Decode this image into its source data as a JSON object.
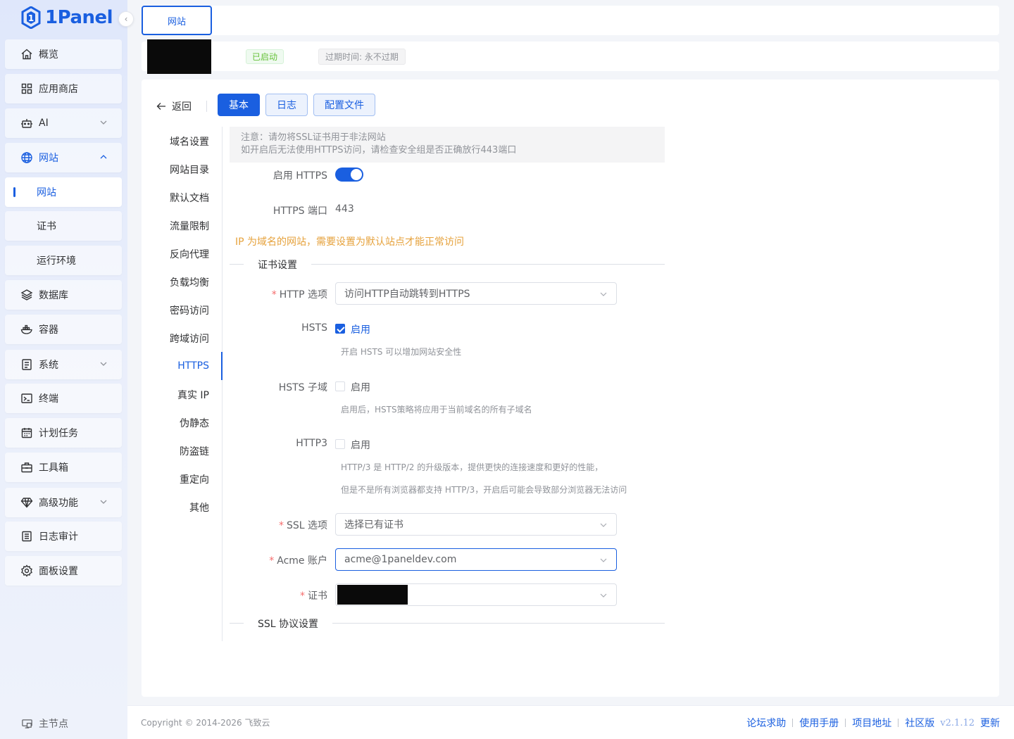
{
  "app": {
    "logo_text": "1Panel",
    "brand_color": "#1a5fe0"
  },
  "sidebar": {
    "items": [
      {
        "label": "概览",
        "icon": "home-icon"
      },
      {
        "label": "应用商店",
        "icon": "apps-grid-icon"
      },
      {
        "label": "AI",
        "icon": "robot-icon"
      },
      {
        "label": "网站",
        "icon": "globe-icon"
      },
      {
        "label": "网站"
      },
      {
        "label": "证书"
      },
      {
        "label": "运行环境"
      },
      {
        "label": "数据库",
        "icon": "layers-icon"
      },
      {
        "label": "容器",
        "icon": "docker-icon"
      },
      {
        "label": "系统",
        "icon": "server-icon"
      },
      {
        "label": "终端",
        "icon": "terminal-icon"
      },
      {
        "label": "计划任务",
        "icon": "calendar-icon"
      },
      {
        "label": "工具箱",
        "icon": "toolbox-icon"
      },
      {
        "label": "高级功能",
        "icon": "diamond-icon"
      },
      {
        "label": "日志审计",
        "icon": "log-icon"
      },
      {
        "label": "面板设置",
        "icon": "gear-icon"
      }
    ],
    "master_node": "主节点"
  },
  "tabs": {
    "active": "网站"
  },
  "site": {
    "status": "已启动",
    "status_color": "#67c23a",
    "expire": "过期时间: 永不过期"
  },
  "toolbar": {
    "back": "返回",
    "basic": "基本",
    "log": "日志",
    "config": "配置文件"
  },
  "leftnav": {
    "items": [
      "域名设置",
      "网站目录",
      "默认文档",
      "流量限制",
      "反向代理",
      "负载均衡",
      "密码访问",
      "跨域访问",
      "HTTPS",
      "真实 IP",
      "伪静态",
      "防盗链",
      "重定向",
      "其他"
    ],
    "active": "HTTPS"
  },
  "https": {
    "notice_line1": "注意：请勿将SSL证书用于非法网站",
    "notice_line2": "如开启后无法使用HTTPS访问，请检查安全组是否正确放行443端口",
    "enable_label": "启用 HTTPS",
    "enable_value": true,
    "port_label": "HTTPS 端口",
    "port_value": "443",
    "ip_warning": "IP 为域名的网站，需要设置为默认站点才能正常访问",
    "cert_section": "证书设置",
    "http_option_label": "HTTP 选项",
    "http_option_value": "访问HTTP自动跳转到HTTPS",
    "hsts_label": "HSTS",
    "hsts_checkbox": "启用",
    "hsts_checked": true,
    "hsts_help": "开启 HSTS 可以增加网站安全性",
    "hsts_sub_label": "HSTS 子域",
    "hsts_sub_checkbox": "启用",
    "hsts_sub_help": "启用后，HSTS策略将应用于当前域名的所有子域名",
    "http3_label": "HTTP3",
    "http3_checkbox": "启用",
    "http3_help1": "HTTP/3 是 HTTP/2 的升级版本，提供更快的连接速度和更好的性能，",
    "http3_help2": "但是不是所有浏览器都支持 HTTP/3，开启后可能会导致部分浏览器无法访问",
    "ssl_option_label": "SSL 选项",
    "ssl_option_value": "选择已有证书",
    "acme_label": "Acme 账户",
    "acme_value": "acme@1paneldev.com",
    "cert_label": "证书",
    "protocol_section": "SSL 协议设置"
  },
  "footer": {
    "copyright": "Copyright © 2014-2026 飞致云",
    "links": [
      "论坛求助",
      "使用手册",
      "项目地址",
      "社区版"
    ],
    "version": "v2.1.12",
    "update": "更新"
  }
}
